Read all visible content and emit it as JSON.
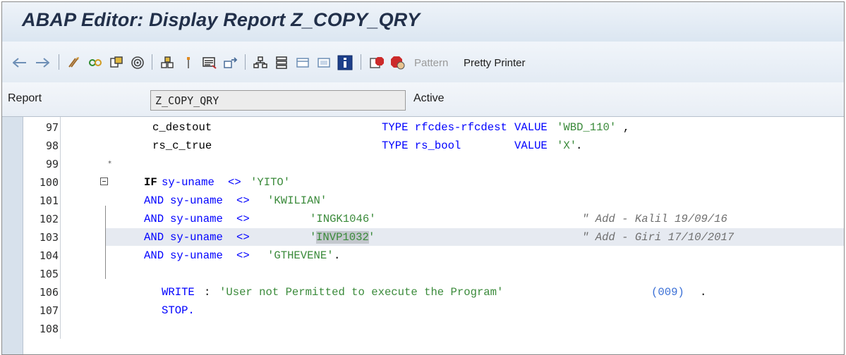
{
  "window": {
    "title": "ABAP Editor: Display Report Z_COPY_QRY"
  },
  "toolbar": {
    "icons": [
      "back-arrow-icon",
      "forward-arrow-icon",
      "other-object-icon",
      "display-change-icon",
      "active-inactive-icon",
      "check-icon",
      "test-direct-icon",
      "where-used-icon",
      "navigation-icon",
      "display-object-list-icon",
      "enhance-icon",
      "hierarchy-icon",
      "screen-icon",
      "help-icon",
      "info-icon",
      "breakpoint-icon",
      "session-breakpoint-icon"
    ],
    "pattern_label": "Pattern",
    "pretty_printer_label": "Pretty Printer"
  },
  "report": {
    "label": "Report",
    "name": "Z_COPY_QRY",
    "status": "Active"
  },
  "editor": {
    "lines": [
      {
        "num": "97",
        "parts": [
          "c_destout",
          "TYPE rfcdes-rfcdest",
          "VALUE",
          "'WBD_110'",
          ","
        ]
      },
      {
        "num": "98",
        "parts": [
          "rs_c_true",
          "TYPE rs_bool",
          "VALUE",
          "'X'",
          "."
        ]
      },
      {
        "num": "99",
        "parts": [
          "*"
        ]
      },
      {
        "num": "100",
        "parts": [
          "IF",
          "sy-uname",
          "<>",
          "'YITO'"
        ]
      },
      {
        "num": "101",
        "parts": [
          "AND",
          "sy-uname",
          "<>",
          "'KWILIAN'"
        ]
      },
      {
        "num": "102",
        "parts": [
          "AND",
          "sy-uname",
          "<>",
          "'INGK1046'",
          "\" Add - Kalil 19/09/16"
        ]
      },
      {
        "num": "103",
        "parts": [
          "AND",
          "sy-uname",
          "<>",
          "'",
          "INVP1032",
          "'",
          "\" Add - Giri 17/10/2017"
        ]
      },
      {
        "num": "104",
        "parts": [
          "AND",
          "sy-uname",
          "<>",
          "'GTHEVENE'",
          "."
        ]
      },
      {
        "num": "105",
        "parts": []
      },
      {
        "num": "106",
        "parts": [
          "WRITE",
          ":",
          "'User not Permitted to execute the Program'",
          "(009)",
          "."
        ]
      },
      {
        "num": "107",
        "parts": [
          "STOP."
        ]
      },
      {
        "num": "108",
        "parts": []
      }
    ]
  },
  "colors": {
    "keyword": "#0000ff",
    "string": "#3a8a3a",
    "comment": "#6f6f6f",
    "number": "#3a6fd6",
    "current_line": "#e6eaf1"
  }
}
